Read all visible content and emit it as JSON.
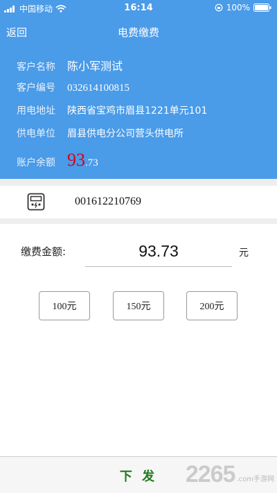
{
  "status_bar": {
    "carrier": "中国移动",
    "time": "16:14",
    "battery": "100%"
  },
  "nav": {
    "back_label": "返回",
    "title": "电费缴费"
  },
  "customer": {
    "name_label": "客户名称",
    "name_value": "陈小军测试",
    "id_label": "客户编号",
    "id_value": "032614100815",
    "address_label": "用电地址",
    "address_value": "陕西省宝鸡市眉县1221单元101",
    "supplier_label": "供电单位",
    "supplier_value": "眉县供电分公司营头供电所",
    "balance_label": "账户余额",
    "balance_int": "93",
    "balance_dec": ".73"
  },
  "meter": {
    "icon": "electric-meter-icon",
    "number": "001612210769"
  },
  "payment": {
    "amount_label": "缴费金额:",
    "amount_value": "93.73",
    "unit": "元",
    "quick_amounts": [
      "100元",
      "150元",
      "200元"
    ]
  },
  "submit_label": "下 发",
  "watermark": {
    "number": "2265",
    "suffix": ".com",
    "site": "手游网"
  },
  "colors": {
    "header_blue": "#4a9be8",
    "balance_red": "#d0021b",
    "submit_green": "#217a1f"
  }
}
